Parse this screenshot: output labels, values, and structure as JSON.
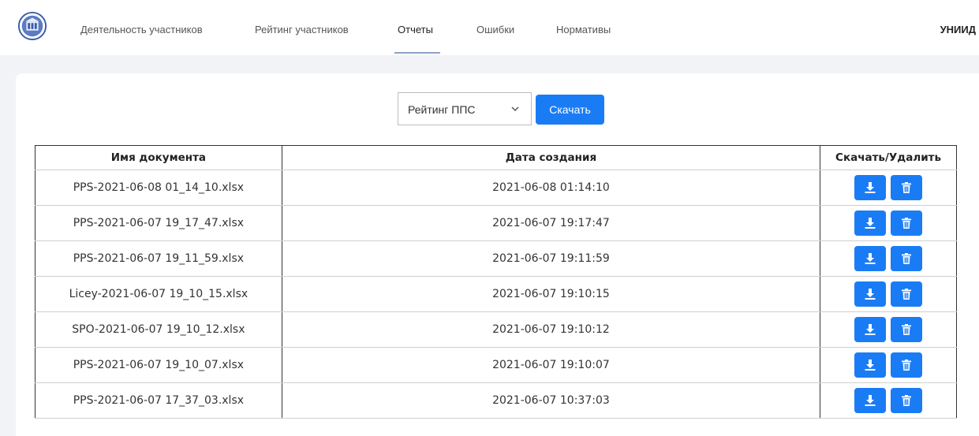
{
  "nav": {
    "items": [
      {
        "label": "Деятельность участников"
      },
      {
        "label": "Рейтинг участников"
      },
      {
        "label": "Отчеты"
      },
      {
        "label": "Ошибки"
      },
      {
        "label": "Нормативы"
      }
    ],
    "active": "Отчеты",
    "brand": "УНИИД"
  },
  "report_select": {
    "selected": "Рейтинг ППС"
  },
  "download_button": {
    "label": "Скачать"
  },
  "table": {
    "headers": [
      "Имя документа",
      "Дата создания",
      "Скачать/Удалить"
    ],
    "rows": [
      {
        "name": "PPS-2021-06-08 01_14_10.xlsx",
        "date": "2021-06-08 01:14:10"
      },
      {
        "name": "PPS-2021-06-07 19_17_47.xlsx",
        "date": "2021-06-07 19:17:47"
      },
      {
        "name": "PPS-2021-06-07 19_11_59.xlsx",
        "date": "2021-06-07 19:11:59"
      },
      {
        "name": "Licey-2021-06-07 19_10_15.xlsx",
        "date": "2021-06-07 19:10:15"
      },
      {
        "name": "SPO-2021-06-07 19_10_12.xlsx",
        "date": "2021-06-07 19:10:12"
      },
      {
        "name": "PPS-2021-06-07 19_10_07.xlsx",
        "date": "2021-06-07 19:10:07"
      },
      {
        "name": "PPS-2021-06-07 17_37_03.xlsx",
        "date": "2021-06-07 10:37:03"
      }
    ],
    "row_actions": {
      "download_icon": "download-icon",
      "delete_icon": "trash-icon"
    }
  },
  "colors": {
    "accent": "#1a7cf5",
    "page_bg": "#f2f3f6"
  }
}
